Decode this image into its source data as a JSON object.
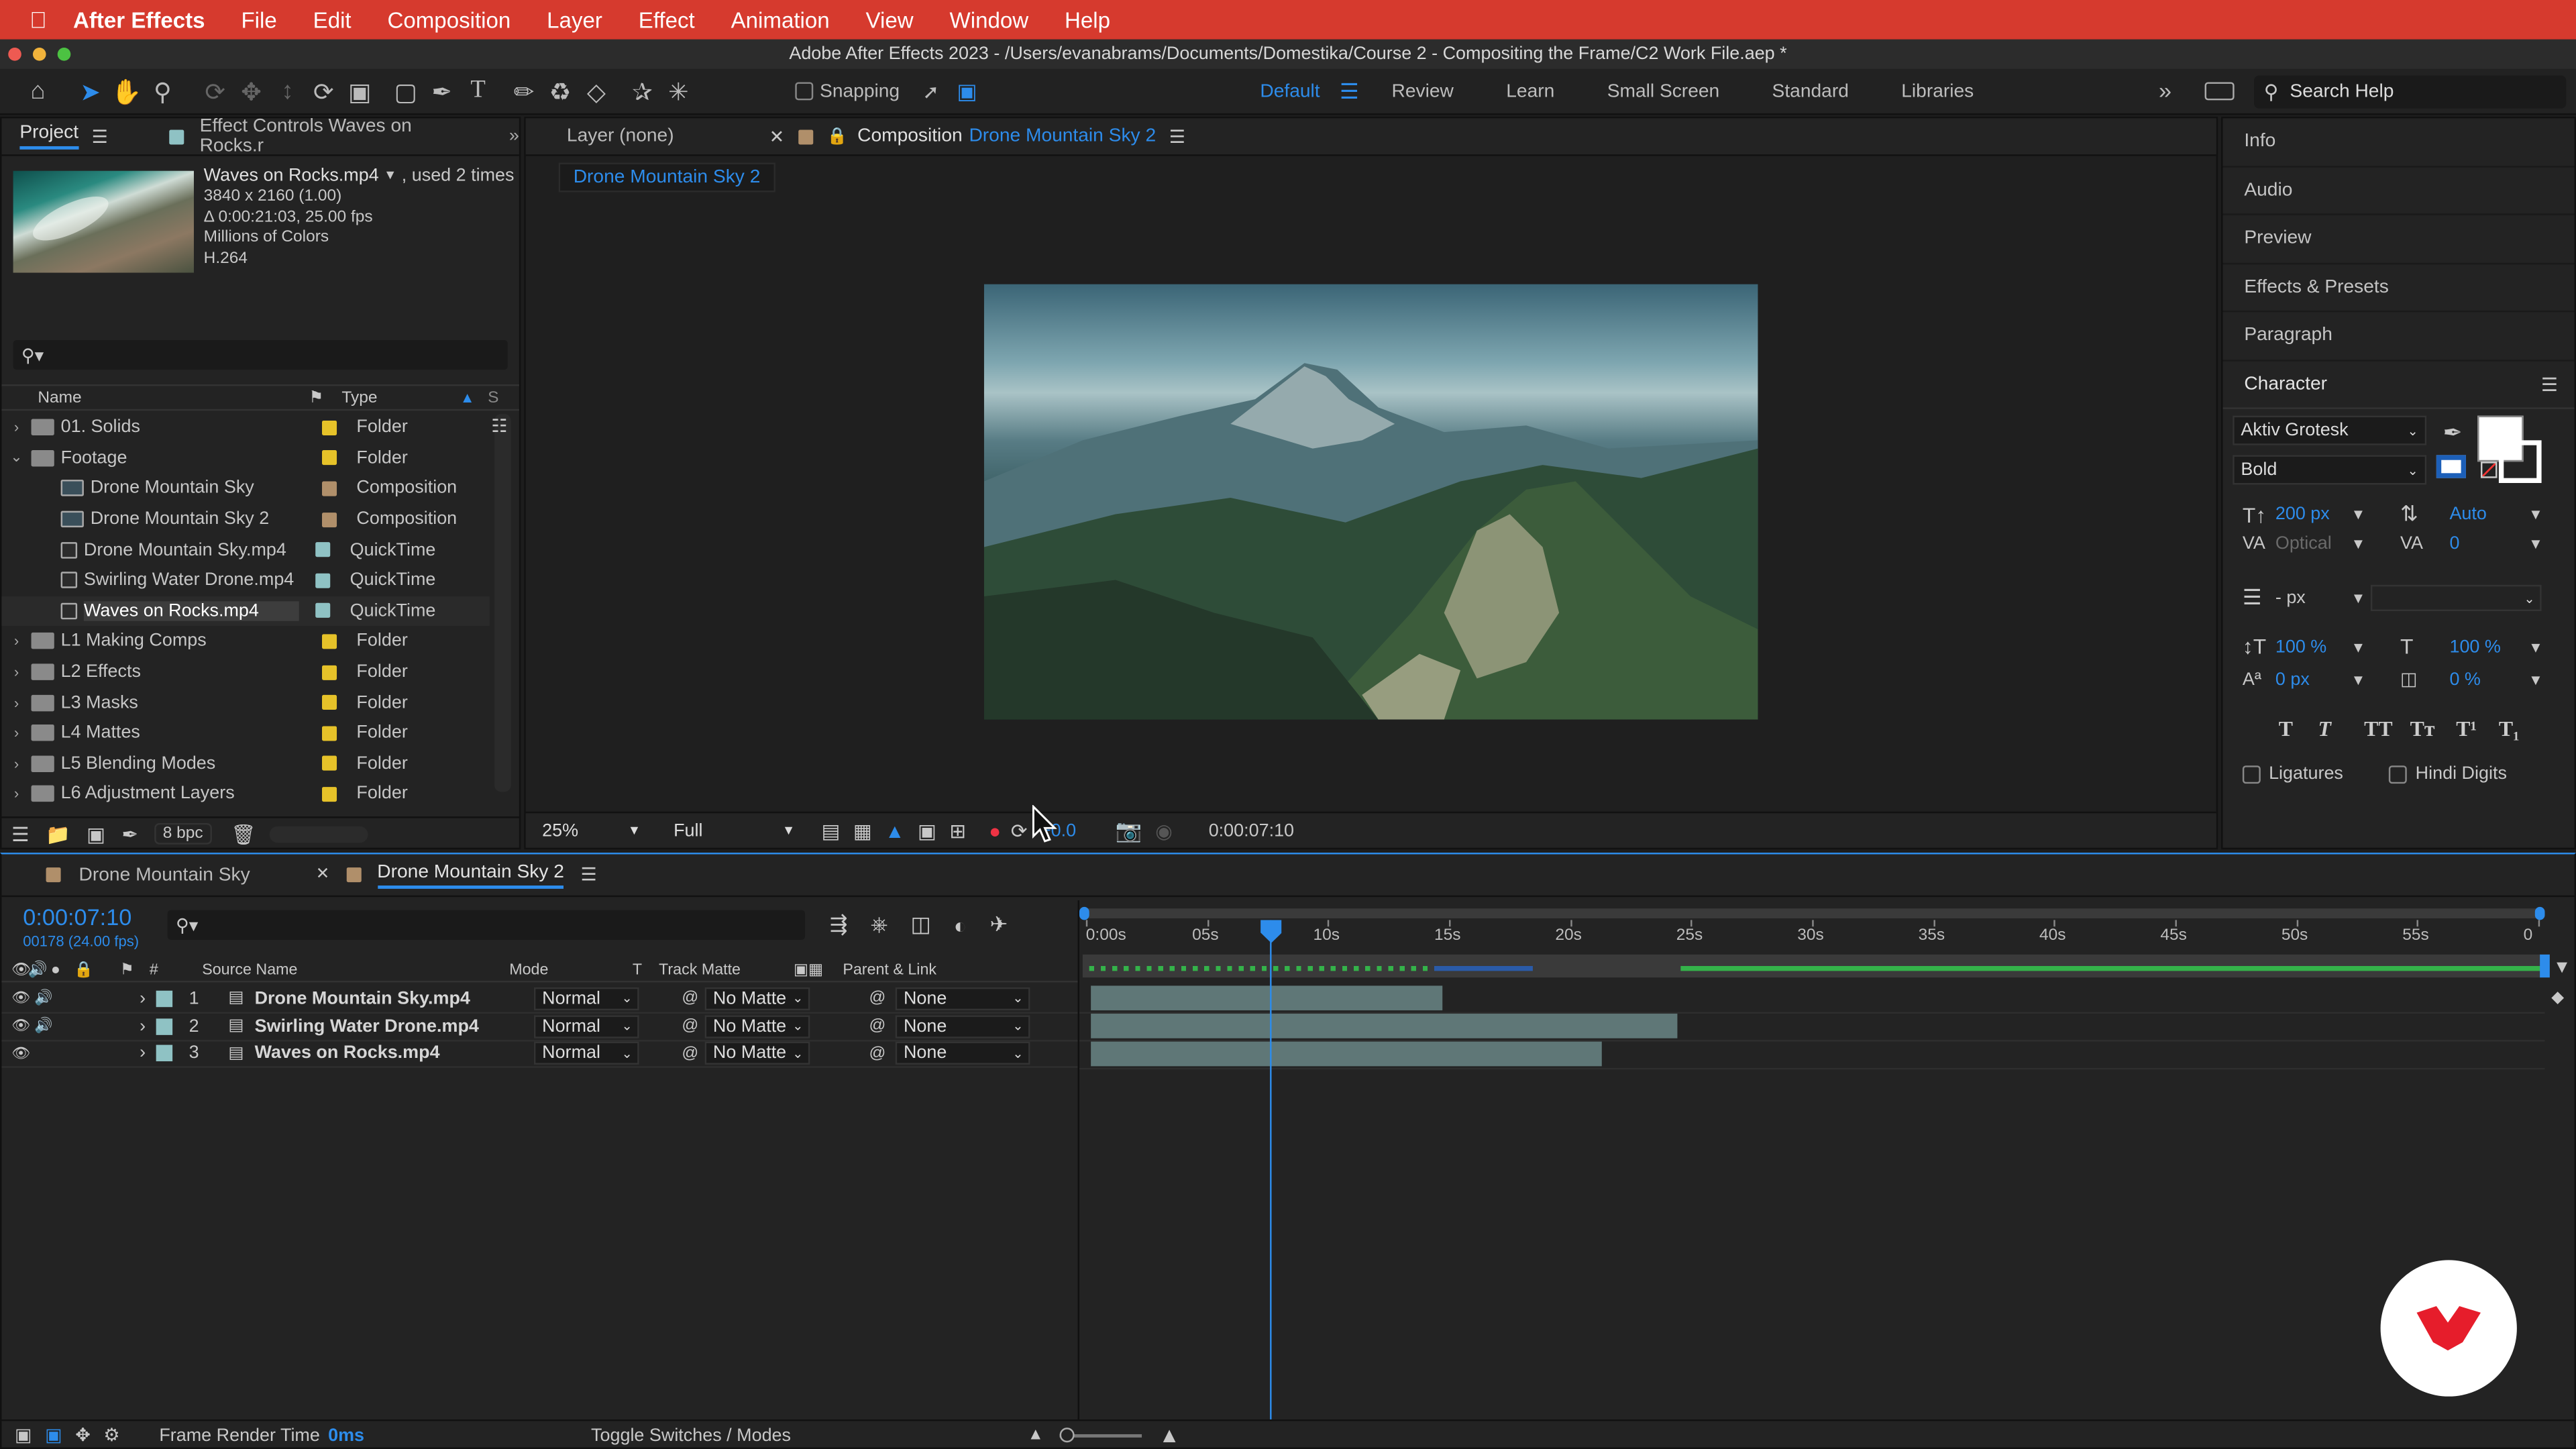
{
  "menubar": {
    "app": "After Effects",
    "items": [
      "File",
      "Edit",
      "Composition",
      "Layer",
      "Effect",
      "Animation",
      "View",
      "Window",
      "Help"
    ]
  },
  "window_title": "Adobe After Effects 2023 - /Users/evanabrams/Documents/Domestika/Course 2 - Compositing the Frame/C2 Work File.aep *",
  "toolbar": {
    "snapping": "Snapping",
    "workspaces": [
      "Default",
      "Review",
      "Learn",
      "Small Screen",
      "Standard",
      "Libraries"
    ],
    "active_workspace": "Default",
    "search_placeholder": "Search Help"
  },
  "project": {
    "tab_project": "Project",
    "tab_effects": "Effect Controls Waves on Rocks.r",
    "selected_name": "Waves on Rocks.mp4",
    "used": ", used 2 times",
    "info": [
      "3840 x 2160 (1.00)",
      "Δ 0:00:21:03, 25.00 fps",
      "Millions of Colors",
      "H.264"
    ],
    "columns": {
      "name": "Name",
      "type": "Type"
    },
    "items": [
      {
        "name": "01. Solids",
        "type": "Folder",
        "color": "#e6c229",
        "indent": 0,
        "icon": "folder"
      },
      {
        "name": "Footage",
        "type": "Folder",
        "color": "#e6c229",
        "indent": 0,
        "icon": "folder"
      },
      {
        "name": "Drone Mountain Sky",
        "type": "Composition",
        "color": "#b08f6a",
        "indent": 1,
        "icon": "comp"
      },
      {
        "name": "Drone Mountain Sky 2",
        "type": "Composition",
        "color": "#b08f6a",
        "indent": 1,
        "icon": "comp"
      },
      {
        "name": "Drone Mountain Sky.mp4",
        "type": "QuickTime",
        "color": "#8fc2c4",
        "indent": 1,
        "icon": "file"
      },
      {
        "name": "Swirling Water Drone.mp4",
        "type": "QuickTime",
        "color": "#8fc2c4",
        "indent": 1,
        "icon": "file"
      },
      {
        "name": "Waves on Rocks.mp4",
        "type": "QuickTime",
        "color": "#8fc2c4",
        "indent": 1,
        "icon": "file"
      },
      {
        "name": "L1 Making Comps",
        "type": "Folder",
        "color": "#e6c229",
        "indent": 0,
        "icon": "folder"
      },
      {
        "name": "L2 Effects",
        "type": "Folder",
        "color": "#e6c229",
        "indent": 0,
        "icon": "folder"
      },
      {
        "name": "L3 Masks",
        "type": "Folder",
        "color": "#e6c229",
        "indent": 0,
        "icon": "folder"
      },
      {
        "name": "L4 Mattes",
        "type": "Folder",
        "color": "#e6c229",
        "indent": 0,
        "icon": "folder"
      },
      {
        "name": "L5 Blending Modes",
        "type": "Folder",
        "color": "#e6c229",
        "indent": 0,
        "icon": "folder"
      },
      {
        "name": "L6 Adjustment Layers",
        "type": "Folder",
        "color": "#e6c229",
        "indent": 0,
        "icon": "folder"
      }
    ],
    "selected_index": 6,
    "bpc": "8 bpc"
  },
  "viewer": {
    "tab_layer": "Layer (none)",
    "tab_comp_prefix": "Composition",
    "tab_comp_name": "Drone Mountain Sky 2",
    "breadcrumb": "Drone Mountain Sky 2",
    "zoom": "25%",
    "resolution": "Full",
    "exposure": "+0.0",
    "timecode": "0:00:07:10"
  },
  "right_panels": {
    "items": [
      "Info",
      "Audio",
      "Preview",
      "Effects & Presets",
      "Paragraph"
    ],
    "character": {
      "title": "Character",
      "font": "Aktiv Grotesk",
      "style": "Bold",
      "size": "200 px",
      "leading": "Auto",
      "kerning": "Optical",
      "tracking": "0",
      "stroke": "- px",
      "vscale": "100 %",
      "hscale": "100 %",
      "baseline": "0 px",
      "tsume": "0 %",
      "styles": [
        "T",
        "T",
        "TT",
        "Tт",
        "T¹",
        "T₁"
      ],
      "ligatures": "Ligatures",
      "hindi": "Hindi Digits"
    }
  },
  "timeline": {
    "tabs": [
      "Drone Mountain Sky",
      "Drone Mountain Sky 2"
    ],
    "timecode": "0:00:07:10",
    "frames": "00178 (24.00 fps)",
    "columns": {
      "num": "#",
      "source": "Source Name",
      "mode": "Mode",
      "t": "T",
      "matte": "Track Matte",
      "parent": "Parent & Link"
    },
    "ruler": [
      "0:00s",
      "05s",
      "10s",
      "15s",
      "20s",
      "25s",
      "30s",
      "35s",
      "40s",
      "45s",
      "50s",
      "55s",
      "0"
    ],
    "duration_s": 60,
    "playhead_s": 7.42,
    "layers": [
      {
        "num": "1",
        "name": "Drone Mountain Sky.mp4",
        "mode": "Normal",
        "matte": "No Matte",
        "parent": "None",
        "color": "#8fc2c4",
        "start": 0,
        "end": 14.5,
        "audio": true
      },
      {
        "num": "2",
        "name": "Swirling Water Drone.mp4",
        "mode": "Normal",
        "matte": "No Matte",
        "parent": "None",
        "color": "#8fc2c4",
        "start": 0,
        "end": 24.2,
        "audio": true
      },
      {
        "num": "3",
        "name": "Waves on Rocks.mp4",
        "mode": "Normal",
        "matte": "No Matte",
        "parent": "None",
        "color": "#8fc2c4",
        "start": 0,
        "end": 21.1,
        "audio": false
      }
    ],
    "footer_label": "Frame Render Time",
    "footer_value": "0ms",
    "toggle": "Toggle Switches / Modes"
  }
}
